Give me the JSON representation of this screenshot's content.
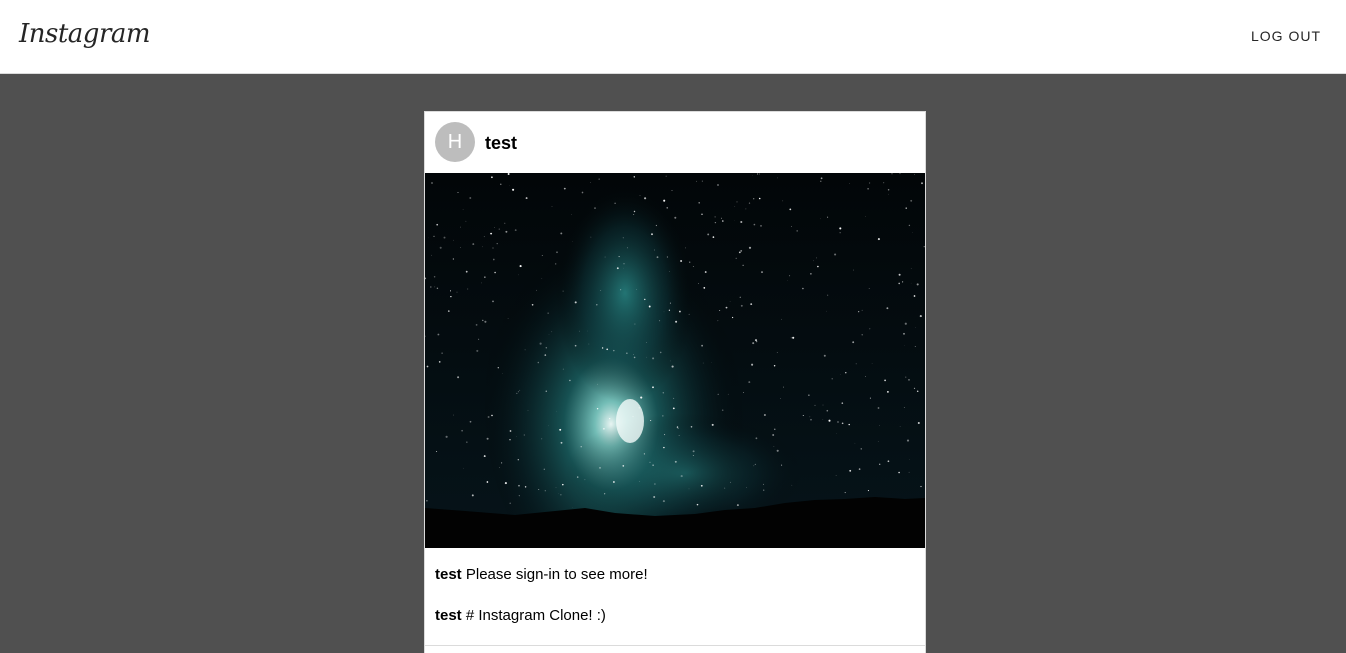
{
  "header": {
    "logo_text": "Instagram",
    "logout_label": "LOG OUT"
  },
  "post": {
    "avatar_initial": "H",
    "username": "test",
    "image_alt": "milky way night sky",
    "captions": [
      {
        "username": "test",
        "text": "Please sign-in to see more!"
      },
      {
        "username": "test",
        "text": "# Instagram Clone! :)"
      }
    ]
  },
  "colors": {
    "page_background": "#505050",
    "header_background": "#ffffff",
    "avatar_background": "#bdbdbd"
  }
}
